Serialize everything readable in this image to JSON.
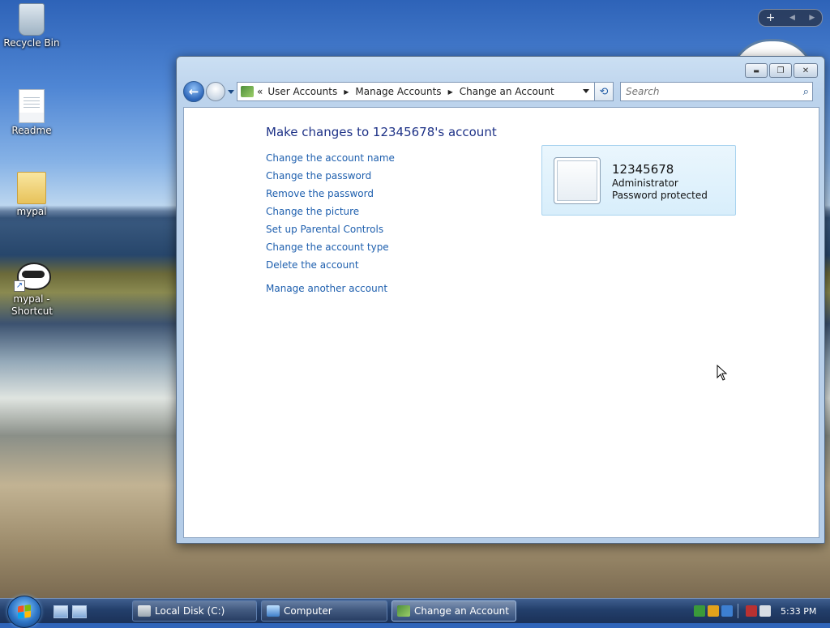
{
  "desktop": {
    "icons": [
      {
        "label": "Recycle Bin",
        "icon": "recycle-bin-icon"
      },
      {
        "label": "Readme",
        "icon": "text-document-icon"
      },
      {
        "label": "mypal",
        "icon": "folder-icon"
      },
      {
        "label": "mypal - Shortcut",
        "icon": "raccoon-app-shortcut-icon"
      }
    ],
    "gadget_bar": {
      "add": "+",
      "prev": "◀",
      "next": "▶"
    }
  },
  "window": {
    "controls": {
      "minimize": "▬",
      "maximize": "❐",
      "close": "✕"
    },
    "nav": {
      "back_glyph": "←",
      "refresh_glyph": "⟲"
    },
    "address": {
      "prefix": "«",
      "crumbs": [
        "User Accounts",
        "Manage Accounts",
        "Change an Account"
      ],
      "separator": "▶"
    },
    "search": {
      "placeholder": "Search",
      "icon": "magnifier-icon",
      "icon_glyph": "⌕"
    },
    "heading": "Make changes to 12345678's account",
    "tasks": [
      "Change the account name",
      "Change the password",
      "Remove the password",
      "Change the picture",
      "Set up Parental Controls",
      "Change the account type",
      "Delete the account"
    ],
    "other_task": "Manage another account",
    "account": {
      "name": "12345678",
      "type": "Administrator",
      "status": "Password protected"
    }
  },
  "taskbar": {
    "buttons": [
      {
        "label": "Local Disk (C:)",
        "active": false
      },
      {
        "label": "Computer",
        "active": false
      },
      {
        "label": "Change an Account",
        "active": true
      }
    ],
    "clock": "5:33 PM"
  },
  "colors": {
    "link": "#1e5fae",
    "heading": "#1e3287",
    "card_bg": "#e3f3fc",
    "taskbar": "#233f6b"
  }
}
